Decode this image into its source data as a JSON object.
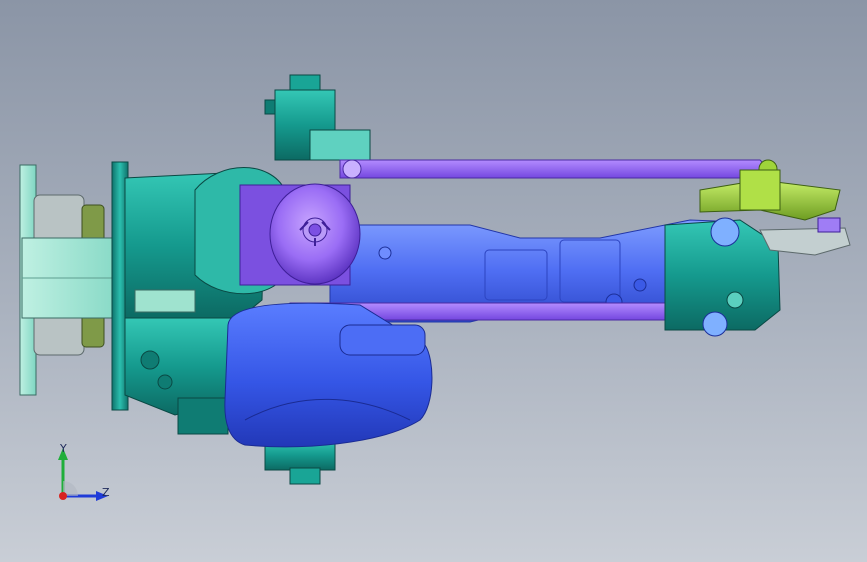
{
  "viewport": {
    "background_top": "#8b95a6",
    "background_bottom": "#c9ced6"
  },
  "model": {
    "colors": {
      "teal": "#1aa89a",
      "teal_dark": "#0f6f68",
      "mint": "#9fe3cf",
      "olive": "#6b8f3a",
      "blue": "#4d6df0",
      "blue_light": "#8fb0ff",
      "violet": "#8f63f0",
      "lime": "#9acd32",
      "gray": "#b7c3c6"
    }
  },
  "triad": {
    "y_label": "Y",
    "z_label": "Z",
    "colors": {
      "y": "#1fae3a",
      "z": "#1f3bd8",
      "x": "#d8231f"
    }
  }
}
